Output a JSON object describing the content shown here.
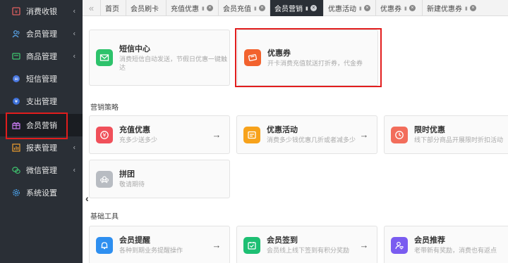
{
  "sidebar": {
    "items": [
      {
        "label": "消费收银",
        "icon": "cashier-icon",
        "arrow": "‹"
      },
      {
        "label": "会员管理",
        "icon": "members-icon",
        "arrow": "‹"
      },
      {
        "label": "商品管理",
        "icon": "goods-icon",
        "arrow": "‹"
      },
      {
        "label": "短信管理",
        "icon": "sms-icon",
        "arrow": ""
      },
      {
        "label": "支出管理",
        "icon": "expense-icon",
        "arrow": ""
      },
      {
        "label": "会员营销",
        "icon": "gift-icon",
        "arrow": ""
      },
      {
        "label": "报表管理",
        "icon": "report-icon",
        "arrow": "‹"
      },
      {
        "label": "微信管理",
        "icon": "wechat-icon",
        "arrow": "‹"
      },
      {
        "label": "系统设置",
        "icon": "settings-icon",
        "arrow": ""
      }
    ]
  },
  "tabs": {
    "prev": "«",
    "items": [
      {
        "label": "首页"
      },
      {
        "label": "会员刷卡"
      },
      {
        "label": "充值优惠"
      },
      {
        "label": "会员充值"
      },
      {
        "label": "会员营销"
      },
      {
        "label": "优惠活动"
      },
      {
        "label": "优惠券"
      },
      {
        "label": "新建优惠券"
      }
    ]
  },
  "main": {
    "top_cards": [
      {
        "title": "短信中心",
        "desc": "消费短信自动发送，节假日优惠一键触达"
      },
      {
        "title": "优惠券",
        "desc": "开卡消费充值就送打折券，代金券"
      }
    ],
    "section_marketing": "营销策略",
    "marketing_cards": [
      {
        "title": "充值优惠",
        "desc": "充多少送多少"
      },
      {
        "title": "优惠活动",
        "desc": "消费多少钱优惠几折或者减多少"
      },
      {
        "title": "限时优惠",
        "desc": "线下部分商品开展限时折扣活动"
      },
      {
        "title": "拼团",
        "desc": "敬请期待"
      }
    ],
    "section_tools": "基础工具",
    "tool_cards": [
      {
        "title": "会员提醒",
        "desc": "各种到期业务提醒操作"
      },
      {
        "title": "会员签到",
        "desc": "会员线上线下签到有积分奖励"
      },
      {
        "title": "会员推荐",
        "desc": "老带新有奖励，消费也有返点"
      }
    ],
    "arrow": "→",
    "collapse": "‹"
  },
  "colors": {
    "sidebar_bg": "#2a2f36",
    "highlight": "#e11d1d",
    "sms_green": "#2dc26b",
    "coupon_orange": "#f2622e",
    "recharge_red": "#f0505a",
    "activity_orange": "#f7a21b",
    "limited_red": "#f26d5b",
    "group_gray": "#b8bcc2",
    "remind_blue": "#2e8ff0",
    "signin_green": "#1dbf73",
    "recommend_purple": "#7a5cf0"
  }
}
